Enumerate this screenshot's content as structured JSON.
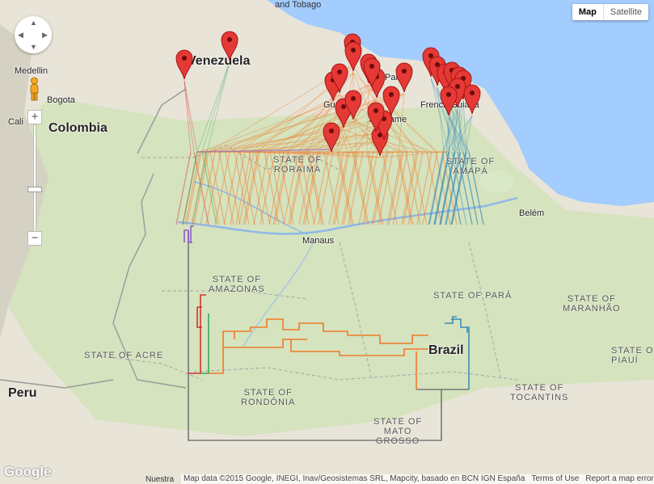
{
  "map": {
    "type_control": {
      "map_label": "Map",
      "satellite_label": "Satellite",
      "selected": "Map"
    },
    "zoom_plus": "+",
    "zoom_minus": "−",
    "logo": "Google",
    "attribution": "Map data ©2015 Google, INEGI, Inav/Geosistemas SRL, Mapcity, basado en BCN IGN España",
    "terms": "Terms of Use",
    "report": "Report a map error",
    "bottom_partial": "Nuestra"
  },
  "labels": {
    "countries": [
      {
        "id": "venezuela",
        "text": "Venezuela"
      },
      {
        "id": "colombia",
        "text": "Colombia"
      },
      {
        "id": "peru",
        "text": "Peru"
      },
      {
        "id": "brazil",
        "text": "Brazil"
      }
    ],
    "states": [
      {
        "id": "roraima",
        "text": "STATE OF\nRORAIMA"
      },
      {
        "id": "amapa",
        "text": "STATE OF\nAMAPÁ"
      },
      {
        "id": "amazonas",
        "text": "STATE OF\nAMAZONAS"
      },
      {
        "id": "para",
        "text": "STATE OF PARÁ"
      },
      {
        "id": "maranhao",
        "text": "STATE OF\nMARANHÃO"
      },
      {
        "id": "acre",
        "text": "STATE OF ACRE"
      },
      {
        "id": "rondonia",
        "text": "STATE OF\nRONDÔNIA"
      },
      {
        "id": "tocantins",
        "text": "STATE OF\nTOCANTINS"
      },
      {
        "id": "piaui",
        "text": "STATE O\nPIAUÍ"
      },
      {
        "id": "matogrosso",
        "text": "STATE OF\nMATO\nGROSSO"
      }
    ],
    "cities": [
      {
        "id": "medellin",
        "text": "Medellin"
      },
      {
        "id": "bogota",
        "text": "Bogota"
      },
      {
        "id": "cali",
        "text": "Cali"
      },
      {
        "id": "manaus",
        "text": "Manaus"
      },
      {
        "id": "belem",
        "text": "Belém"
      },
      {
        "id": "suriname",
        "text": "Suriname"
      },
      {
        "id": "guyana",
        "text": "Gu"
      },
      {
        "id": "frenchguiana",
        "text": "French Guiana"
      },
      {
        "id": "paramaribo",
        "text": "Para"
      },
      {
        "id": "tobago",
        "text": "and Tobago"
      }
    ]
  },
  "overlay": {
    "colors": {
      "orange": "#f07a2a",
      "red": "#d83030",
      "green": "#3aa855",
      "teal": "#3b8fb8",
      "purple": "#8a5cc8",
      "gray": "#777777",
      "pin": "#e53935"
    }
  }
}
